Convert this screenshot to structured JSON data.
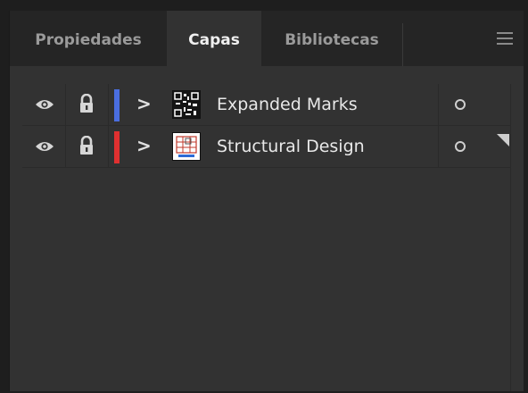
{
  "tabs": [
    {
      "label": "Propiedades",
      "active": false
    },
    {
      "label": "Capas",
      "active": true
    },
    {
      "label": "Bibliotecas",
      "active": false
    }
  ],
  "menu_icon": "hamburger-icon",
  "layers": [
    {
      "name": "Expanded Marks",
      "color": "#4a6ee0",
      "visibility_icon": "eye-icon",
      "lock_icon": "lock-icon",
      "expand_icon": "chevron-right-icon",
      "target_icon": "target-circle-icon"
    },
    {
      "name": "Structural Design",
      "color": "#e03030",
      "visibility_icon": "eye-icon",
      "lock_icon": "lock-icon",
      "expand_icon": "chevron-right-icon",
      "target_icon": "target-circle-icon"
    }
  ]
}
